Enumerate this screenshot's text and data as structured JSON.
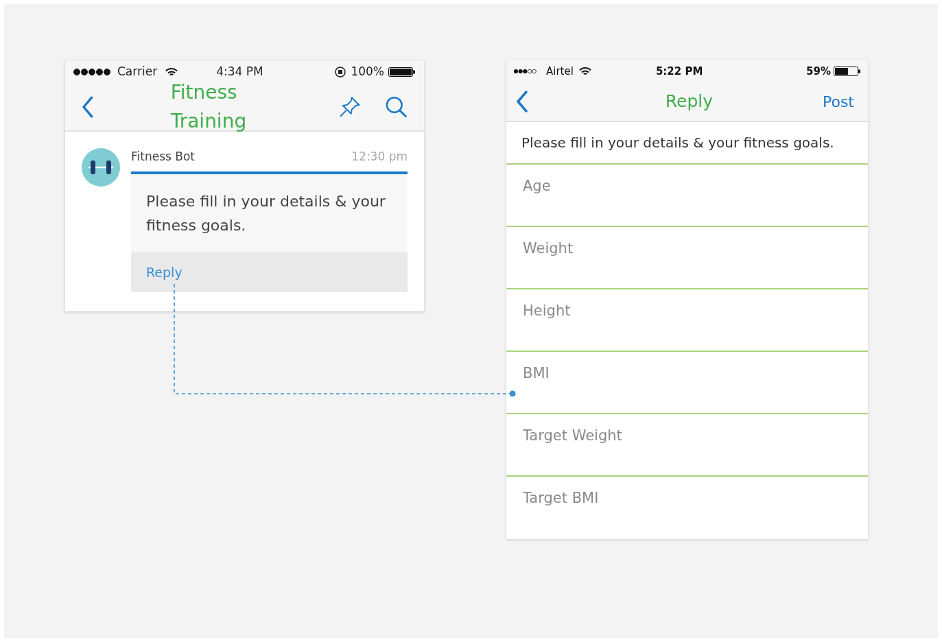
{
  "chat_screen": {
    "status_bar": {
      "carrier": "Carrier",
      "time": "4:34 PM",
      "battery": "100%"
    },
    "nav": {
      "title": "Fitness Training"
    },
    "message": {
      "sender": "Fitness Bot",
      "time": "12:30 pm",
      "text": "Please fill in your details & your fitness goals.",
      "action": "Reply"
    }
  },
  "reply_screen": {
    "status_bar": {
      "carrier": "Airtel",
      "time": "5:22 PM",
      "battery": "59%"
    },
    "nav": {
      "title": "Reply",
      "action": "Post"
    },
    "prompt": "Please fill in your details & your fitness goals.",
    "fields": [
      {
        "placeholder": "Age"
      },
      {
        "placeholder": "Weight"
      },
      {
        "placeholder": "Height"
      },
      {
        "placeholder": "BMI"
      },
      {
        "placeholder": "Target Weight"
      },
      {
        "placeholder": "Target BMI"
      }
    ]
  }
}
